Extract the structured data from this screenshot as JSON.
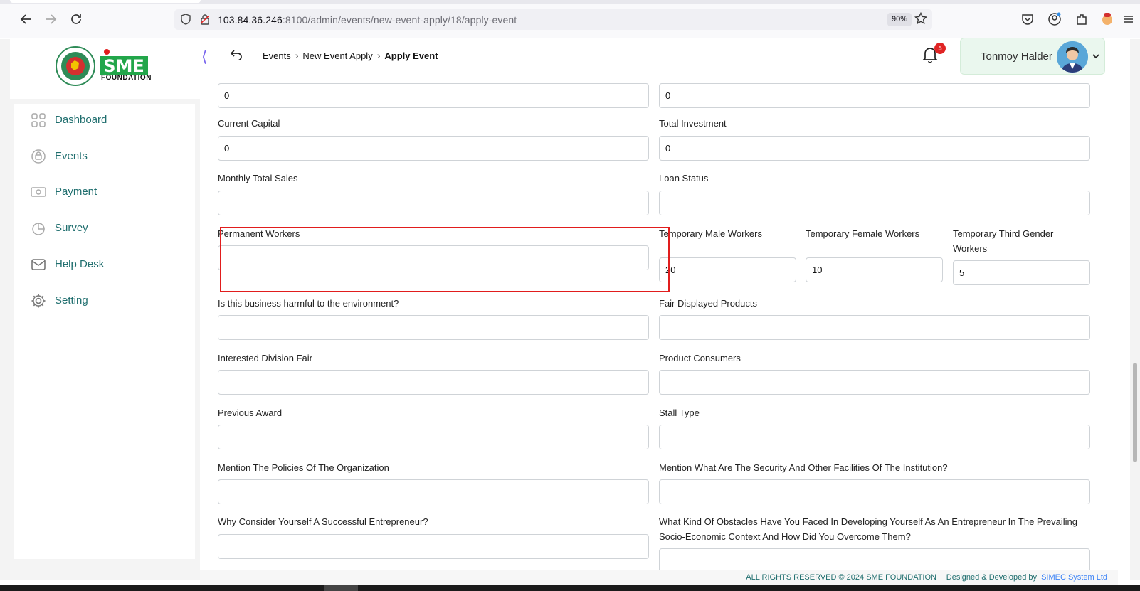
{
  "browser": {
    "url_host": "103.84.36.246",
    "url_rest": ":8100/admin/events/new-event-apply/18/apply-event",
    "zoom": "90%"
  },
  "sidebar": {
    "logo_text": "SME",
    "logo_sub": "FOUNDATION",
    "items": [
      {
        "label": "Dashboard",
        "icon": "dashboard-icon"
      },
      {
        "label": "Events",
        "icon": "events-icon"
      },
      {
        "label": "Payment",
        "icon": "payment-icon"
      },
      {
        "label": "Survey",
        "icon": "survey-icon"
      },
      {
        "label": "Help Desk",
        "icon": "mail-icon"
      },
      {
        "label": "Setting",
        "icon": "gear-icon"
      }
    ]
  },
  "header": {
    "breadcrumbs": [
      "Events",
      "New Event Apply",
      "Apply Event"
    ],
    "notification_count": "5",
    "user_name": "Tonmoy Halder"
  },
  "form": {
    "top_left_value": "0",
    "top_right_value": "0",
    "current_capital": {
      "label": "Current Capital",
      "value": "0"
    },
    "total_investment": {
      "label": "Total Investment",
      "value": "0"
    },
    "monthly_total_sales": {
      "label": "Monthly Total Sales",
      "value": ""
    },
    "loan_status": {
      "label": "Loan Status",
      "value": ""
    },
    "permanent_workers": {
      "label": "Permanent Workers",
      "value": ""
    },
    "temp_male": {
      "label": "Temporary Male Workers",
      "value": "20"
    },
    "temp_female": {
      "label": "Temporary Female Workers",
      "value": "10"
    },
    "temp_third": {
      "label_line1": "Temporary Third Gender",
      "label_line2": "Workers",
      "value": "5"
    },
    "harmful_env": {
      "label": "Is this business harmful to the environment?",
      "value": ""
    },
    "fair_products": {
      "label": "Fair Displayed Products",
      "value": ""
    },
    "division_fair": {
      "label": "Interested Division Fair",
      "value": ""
    },
    "product_consumers": {
      "label": "Product Consumers",
      "value": ""
    },
    "previous_award": {
      "label": "Previous Award",
      "value": ""
    },
    "stall_type": {
      "label": "Stall Type",
      "value": ""
    },
    "policies": {
      "label": "Mention The Policies Of The Organization",
      "value": ""
    },
    "security": {
      "label": "Mention What Are The Security And Other Facilities Of The Institution?",
      "value": ""
    },
    "successful": {
      "label": "Why Consider Yourself A Successful Entrepreneur?",
      "value": ""
    },
    "obstacles": {
      "label_line1": "What Kind Of Obstacles Have You Faced In Developing Yourself As An Entrepreneur In The Prevailing",
      "label_line2": "Socio-Economic Context And How Did You Overcome Them?",
      "value": ""
    }
  },
  "footer": {
    "rights": "ALL RIGHTS RESERVED © 2024 SME FOUNDATION",
    "designed": "Designed & Developed by",
    "company": "SIMEC System Ltd"
  },
  "colors": {
    "accent": "#1f6e6e",
    "highlight": "#e11d1d",
    "badge": "#e02424"
  }
}
